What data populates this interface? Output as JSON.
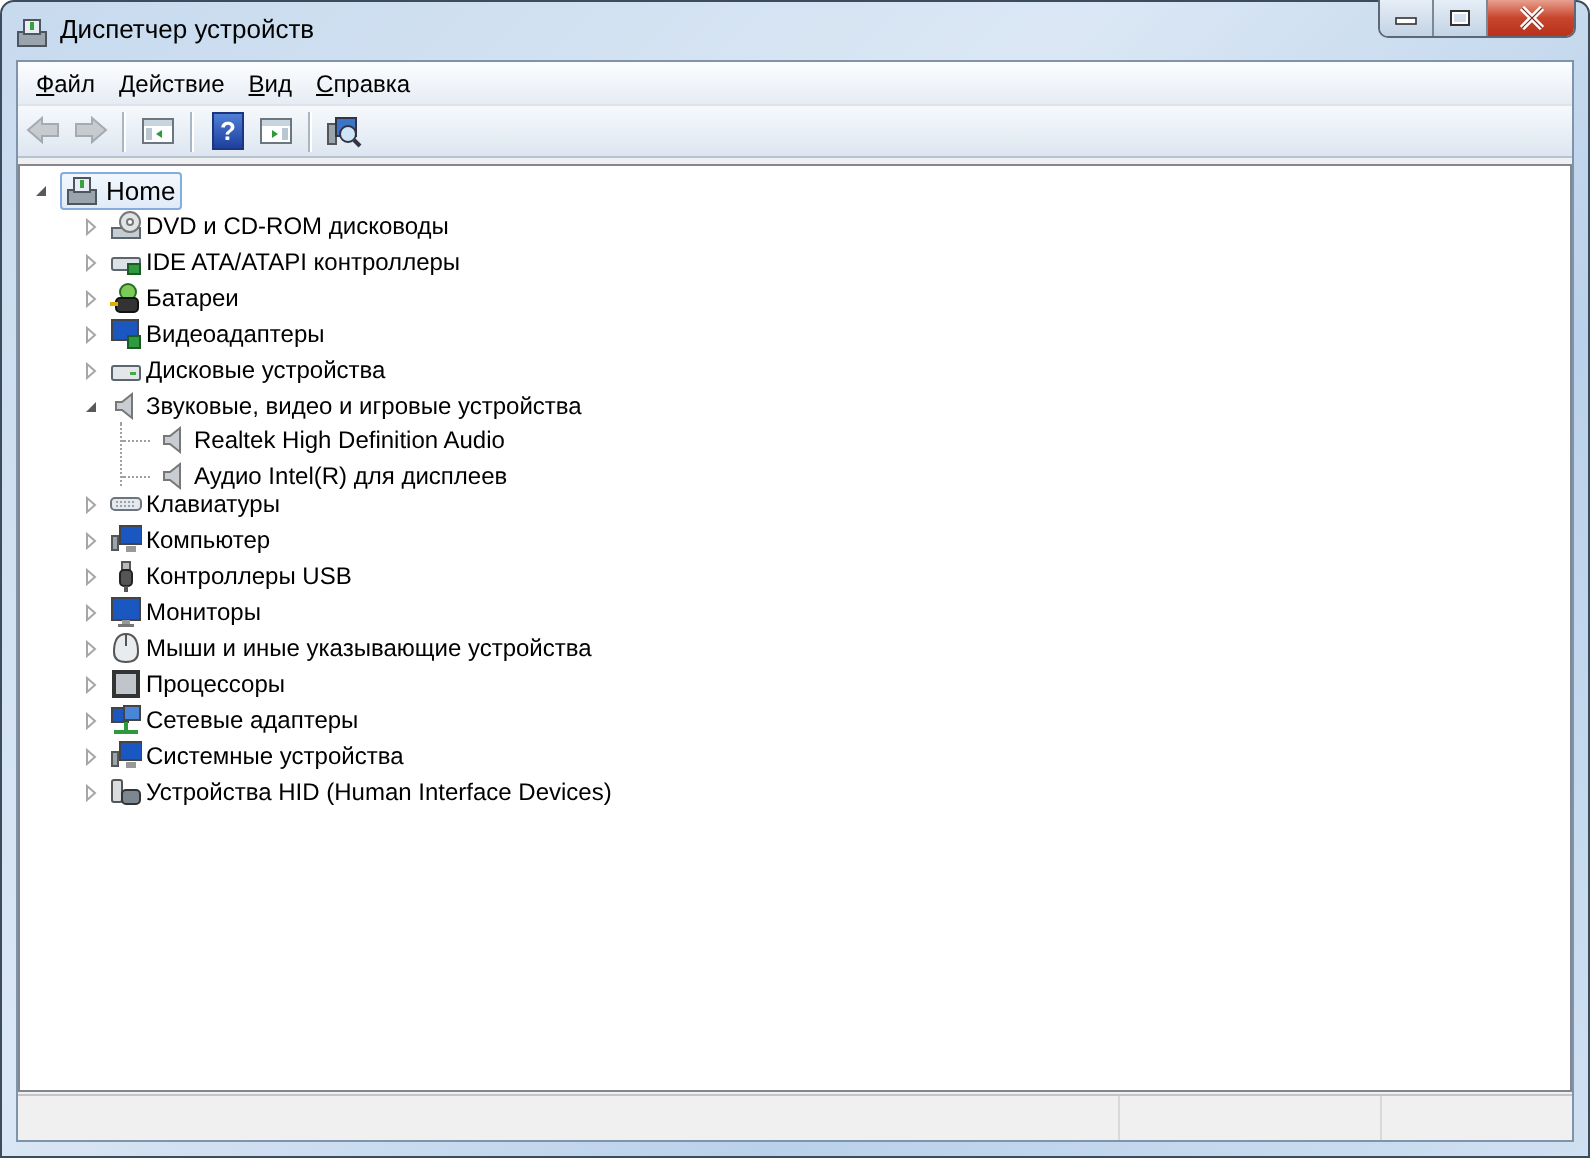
{
  "window": {
    "title": "Диспетчер устройств"
  },
  "menu": [
    {
      "label": "Файл"
    },
    {
      "label": "Действие"
    },
    {
      "label": "Вид"
    },
    {
      "label": "Справка"
    }
  ],
  "toolbar": [
    {
      "kind": "back",
      "disabled": true
    },
    {
      "kind": "forward",
      "disabled": true
    },
    {
      "kind": "separator"
    },
    {
      "kind": "pane"
    },
    {
      "kind": "separator"
    },
    {
      "kind": "help",
      "label": "?"
    },
    {
      "kind": "pane2"
    },
    {
      "kind": "separator"
    },
    {
      "kind": "scan"
    }
  ],
  "tree": {
    "label": "Home",
    "expanded": true,
    "selected": true,
    "children": [
      {
        "label": "DVD и CD-ROM дисководы",
        "expanded": false
      },
      {
        "label": "IDE ATA/ATAPI контроллеры",
        "expanded": false
      },
      {
        "label": "Батареи",
        "expanded": false
      },
      {
        "label": "Видеоадаптеры",
        "expanded": false
      },
      {
        "label": "Дисковые устройства",
        "expanded": false
      },
      {
        "label": "Звуковые, видео и игровые устройства",
        "expanded": true,
        "children": [
          {
            "label": "Realtek High Definition Audio"
          },
          {
            "label": "Аудио Intel(R) для дисплеев"
          }
        ]
      },
      {
        "label": "Клавиатуры",
        "expanded": false
      },
      {
        "label": "Компьютер",
        "expanded": false
      },
      {
        "label": "Контроллеры USB",
        "expanded": false
      },
      {
        "label": "Мониторы",
        "expanded": false
      },
      {
        "label": "Мыши и иные указывающие устройства",
        "expanded": false
      },
      {
        "label": "Процессоры",
        "expanded": false
      },
      {
        "label": "Сетевые адаптеры",
        "expanded": false
      },
      {
        "label": "Системные устройства",
        "expanded": false
      },
      {
        "label": "Устройства HID (Human Interface Devices)",
        "expanded": false
      }
    ]
  }
}
